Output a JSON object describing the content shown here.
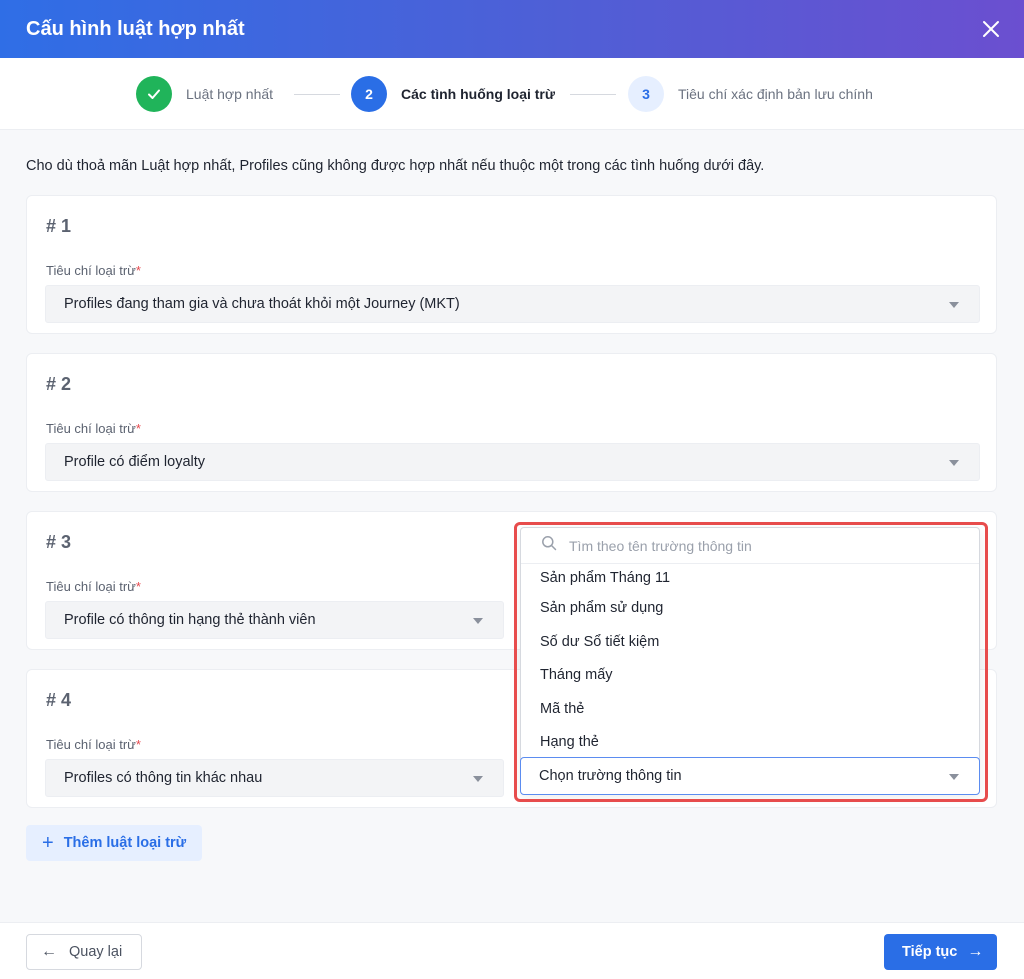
{
  "header": {
    "title": "Cấu hình luật hợp nhất"
  },
  "stepper": {
    "steps": [
      {
        "number": "✓",
        "label": "Luật hợp nhất",
        "state": "done"
      },
      {
        "number": "2",
        "label": "Các tình huống loại trừ",
        "state": "active"
      },
      {
        "number": "3",
        "label": "Tiêu chí xác định bản lưu chính",
        "state": "todo"
      }
    ]
  },
  "intro": "Cho dù thoả mãn Luật hợp nhất, Profiles cũng không được hợp nhất nếu thuộc một trong các tình huống dưới đây.",
  "field_label": "Tiêu chí loại trừ",
  "required_mark": "*",
  "rules": [
    {
      "number": "# 1",
      "value": "Profiles đang tham gia và chưa thoát khỏi một Journey (MKT)"
    },
    {
      "number": "# 2",
      "value": "Profile có điểm loyalty"
    },
    {
      "number": "# 3",
      "value": "Profile có thông tin hạng thẻ thành viên"
    },
    {
      "number": "# 4",
      "value": "Profiles có thông tin khác nhau"
    }
  ],
  "dropdown": {
    "search_placeholder": "Tìm theo tên trường thông tin",
    "options": [
      "Sản phẩm Tháng 11",
      "Sản phẩm sử dụng",
      "Số dư Sổ tiết kiệm",
      "Tháng mấy",
      "Mã thẻ",
      "Hạng thẻ"
    ],
    "selected_placeholder": "Chọn trường thông tin"
  },
  "add_button": {
    "icon": "+",
    "label": "Thêm luật loại trừ"
  },
  "footer": {
    "back_label": "Quay lại",
    "back_icon": "←",
    "next_label": "Tiếp tục",
    "next_icon": "→"
  },
  "colors": {
    "primary": "#2a6ee6",
    "success": "#20b45a",
    "highlight": "#e74c4c",
    "required": "#e5484d"
  }
}
